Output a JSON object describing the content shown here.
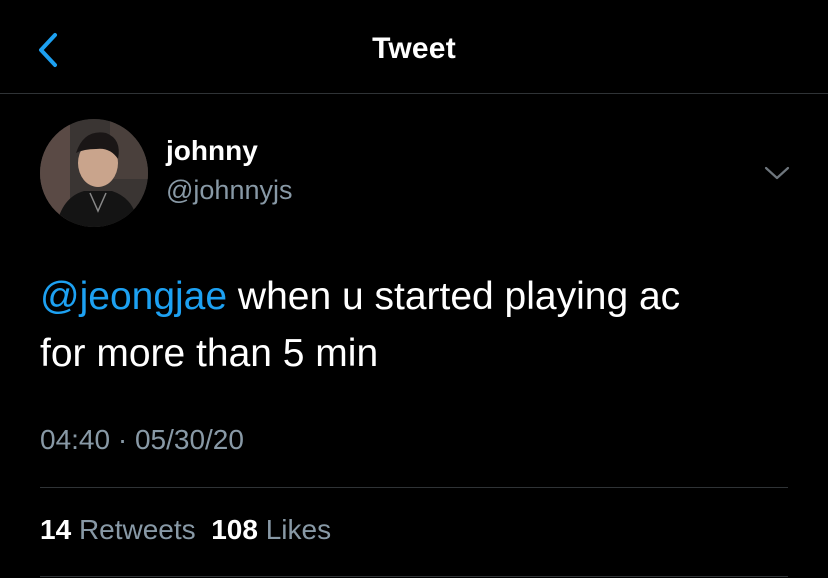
{
  "header": {
    "title": "Tweet",
    "back_icon": "chevron-left-icon"
  },
  "colors": {
    "background": "#000000",
    "accent": "#1da1f2",
    "secondary_text": "#8899a6",
    "divider": "#2f3336"
  },
  "tweet": {
    "author": {
      "display_name": "johnny",
      "handle": "@johnnyjs"
    },
    "menu_icon": "chevron-down-icon",
    "mention": "@jeongjae",
    "text_line1": " when u started playing ac",
    "text_line2": "for more than 5 min",
    "timestamp": "04:40 · 05/30/20",
    "stats": {
      "retweets_count": "14",
      "retweets_label": "Retweets",
      "likes_count": "108",
      "likes_label": "Likes"
    }
  }
}
